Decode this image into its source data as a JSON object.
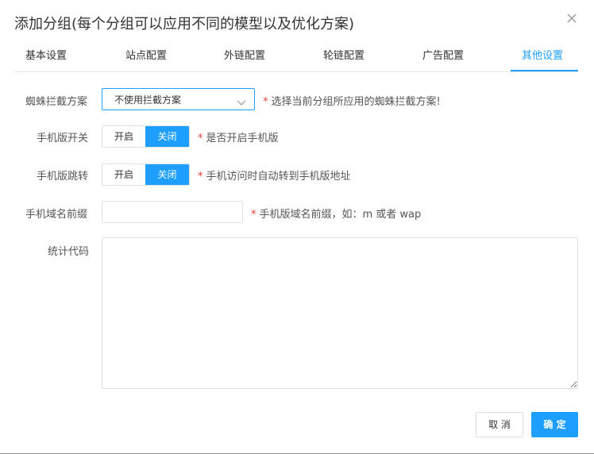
{
  "dialog": {
    "title": "添加分组(每个分组可以应用不同的模型以及优化方案)",
    "close_icon": "close-icon"
  },
  "tabs": [
    {
      "label": "基本设置",
      "active": false
    },
    {
      "label": "站点配置",
      "active": false
    },
    {
      "label": "外链配置",
      "active": false
    },
    {
      "label": "轮链配置",
      "active": false
    },
    {
      "label": "广告配置",
      "active": false
    },
    {
      "label": "其他设置",
      "active": true
    }
  ],
  "colors": {
    "accent": "#1e9fff",
    "required_star": "#e53935"
  },
  "form": {
    "spider": {
      "label": "蜘蛛拦截方案",
      "selected": "不使用拦截方案",
      "hint": "选择当前分组所应用的蜘蛛拦截方案!"
    },
    "mobile_switch": {
      "label": "手机版开关",
      "on_label": "开启",
      "off_label": "关闭",
      "selected": "关闭",
      "hint": "是否开启手机版"
    },
    "mobile_redirect": {
      "label": "手机版跳转",
      "on_label": "开启",
      "off_label": "关闭",
      "selected": "关闭",
      "hint": "手机访问时自动转到手机版地址"
    },
    "mobile_prefix": {
      "label": "手机域名前缀",
      "value": "",
      "hint": "手机版域名前缀，如：m 或者 wap"
    },
    "stats_code": {
      "label": "统计代码",
      "value": ""
    },
    "required_mark": "*"
  },
  "footer": {
    "cancel_label": "取 消",
    "ok_label": "确 定"
  }
}
